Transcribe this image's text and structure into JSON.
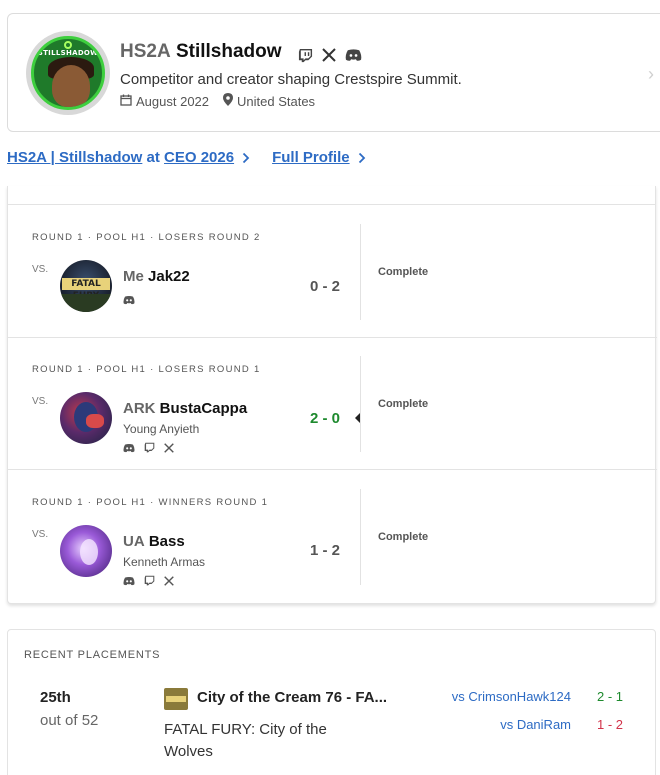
{
  "profile": {
    "prefix": "HS2A",
    "tag": "Stillshadow",
    "bio": "Competitor and creator shaping Crestspire Summit.",
    "joined": "August 2022",
    "location": "United States",
    "avatar_text": "STILLSHADOW",
    "socials": [
      "twitch-icon",
      "x-icon",
      "discord-icon"
    ]
  },
  "links": {
    "event_prefix": "HS2A | Stillshadow",
    "event_at": "at",
    "event_name": "CEO 2026",
    "full_profile": "Full Profile"
  },
  "sets": [
    {
      "round": "ROUND 1 · POOL H1 · LOSERS ROUND 2",
      "vs": "VS.",
      "opponent_prefix": "Me",
      "opponent_tag": "Jak22",
      "opponent_real": "",
      "icons": [
        "discord-icon"
      ],
      "score": "0 - 2",
      "won": false,
      "status": "Complete"
    },
    {
      "round": "ROUND 1 · POOL H1 · LOSERS ROUND 1",
      "vs": "VS.",
      "opponent_prefix": "ARK",
      "opponent_tag": "BustaCappa",
      "opponent_real": "Young Anyieth",
      "icons": [
        "discord-icon",
        "twitch-icon",
        "x-icon"
      ],
      "score": "2 - 0",
      "won": true,
      "status": "Complete"
    },
    {
      "round": "ROUND 1 · POOL H1 · WINNERS ROUND 1",
      "vs": "VS.",
      "opponent_prefix": "UA",
      "opponent_tag": "Bass",
      "opponent_real": "Kenneth Armas",
      "icons": [
        "discord-icon",
        "twitch-icon",
        "x-icon"
      ],
      "score": "1 - 2",
      "won": false,
      "status": "Complete"
    }
  ],
  "placements": {
    "title": "RECENT PLACEMENTS",
    "items": [
      {
        "rank": "25th",
        "out_of": "out of 52",
        "event": "City of the Cream 76 - FA...",
        "game": "FATAL FURY: City of the Wolves",
        "results": [
          {
            "opponent": "vs CrimsonHawk124",
            "score": "2 - 1",
            "won": true
          },
          {
            "opponent": "vs DaniRam",
            "score": "1 - 2",
            "won": false
          }
        ]
      }
    ]
  },
  "colors": {
    "link": "#2d6bc4",
    "win": "#1e8a2e",
    "loss": "#d2334a",
    "avatar_ring": "#3ecf3e"
  }
}
